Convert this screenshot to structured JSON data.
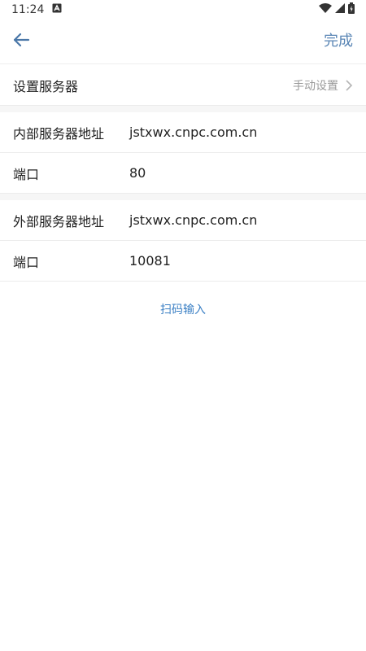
{
  "status_bar": {
    "time": "11:24"
  },
  "app_bar": {
    "done_label": "完成"
  },
  "server": {
    "label": "设置服务器",
    "mode": "手动设置"
  },
  "internal": {
    "address_label": "内部服务器地址",
    "address_value": "jstxwx.cnpc.com.cn",
    "port_label": "端口",
    "port_value": "80"
  },
  "external": {
    "address_label": "外部服务器地址",
    "address_value": "jstxwx.cnpc.com.cn",
    "port_label": "端口",
    "port_value": "10081"
  },
  "scan_label": "扫码输入",
  "colors": {
    "accent": "#5a86b5",
    "link": "#3a7fc4",
    "divider": "#ececec"
  }
}
